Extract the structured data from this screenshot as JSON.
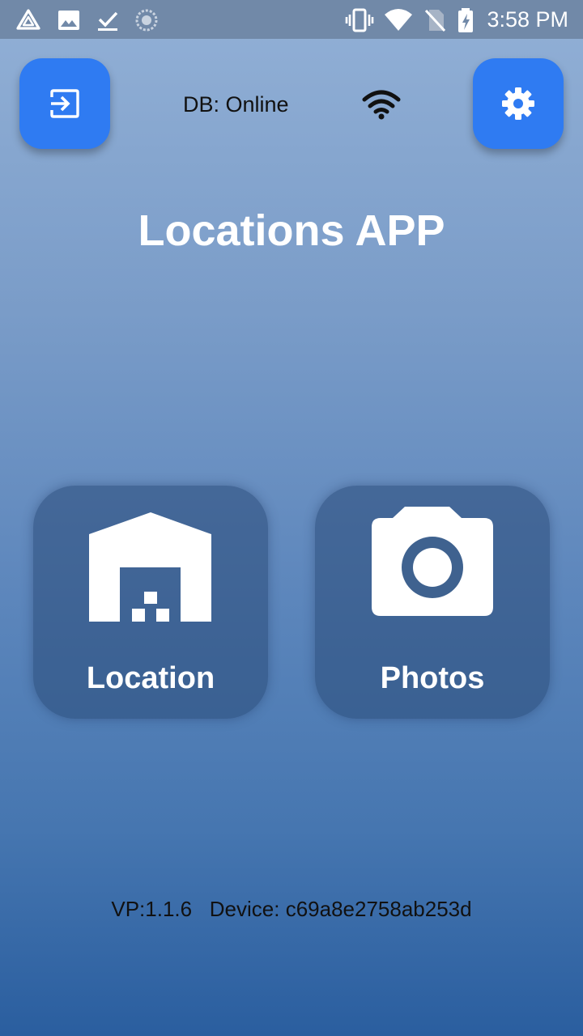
{
  "status_bar": {
    "time": "3:58 PM",
    "left_icons": [
      "app-logo-icon",
      "image-icon",
      "download-done-icon",
      "sync-spinner-icon"
    ],
    "right_icons": [
      "vibrate-icon",
      "wifi-icon",
      "no-sim-icon",
      "battery-charging-icon"
    ]
  },
  "header": {
    "login_icon": "login-icon",
    "settings_icon": "gear-icon",
    "db_status": "DB: Online",
    "connection_icon": "wifi-icon"
  },
  "app": {
    "title": "Locations APP"
  },
  "tiles": [
    {
      "label": "Location",
      "icon": "warehouse-icon"
    },
    {
      "label": "Photos",
      "icon": "camera-icon"
    }
  ],
  "footer": {
    "version_info": "VP:1.1.6   Device: c69a8e2758ab253d"
  },
  "colors": {
    "accent": "#2f7bf2",
    "status_bar": "#7189a8",
    "tile": "#3f628f"
  }
}
